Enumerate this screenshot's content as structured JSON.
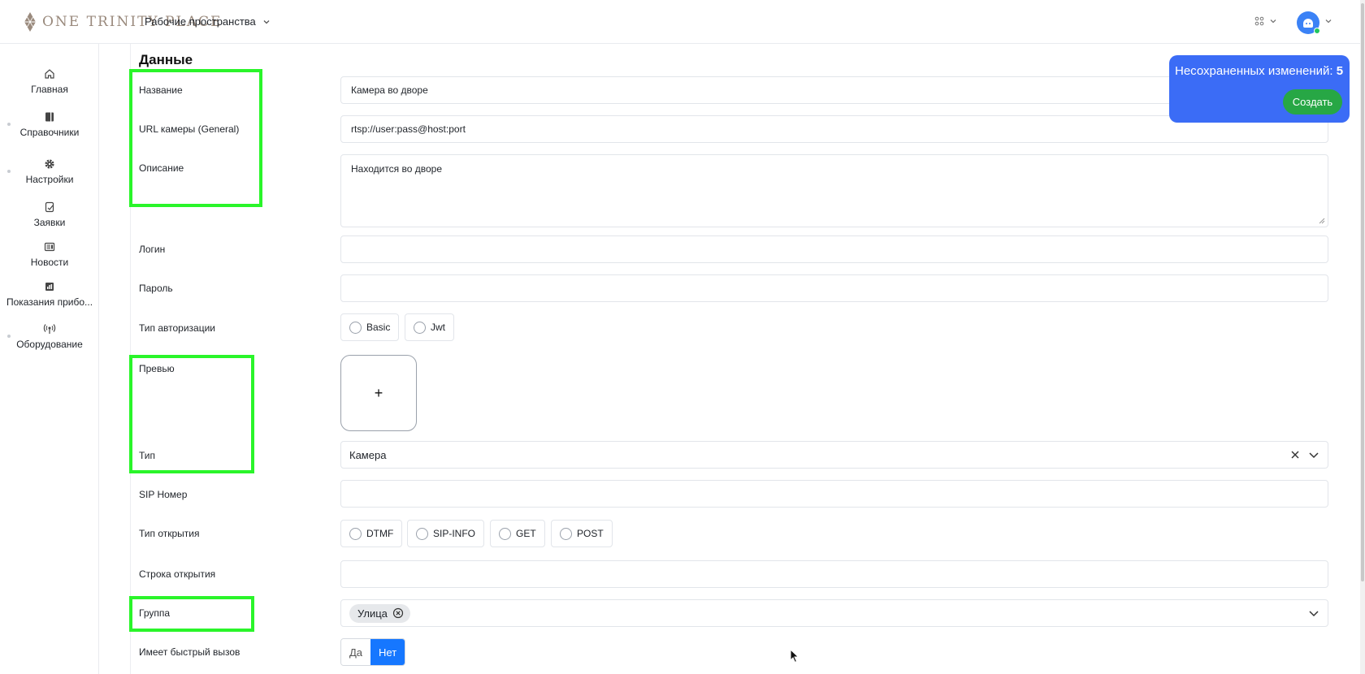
{
  "header": {
    "logo_text": "ONE TRINITY PLACE",
    "workspaces_label": "Рабочие пространства"
  },
  "sidebar": {
    "items": [
      {
        "label": "Главная",
        "icon": "home-icon"
      },
      {
        "label": "Справочники",
        "icon": "book-icon"
      },
      {
        "label": "Настройки",
        "icon": "gear-icon"
      },
      {
        "label": "Заявки",
        "icon": "request-icon"
      },
      {
        "label": "Новости",
        "icon": "news-icon"
      },
      {
        "label": "Показания прибо...",
        "icon": "chart-icon"
      },
      {
        "label": "Оборудование",
        "icon": "antenna-icon"
      }
    ]
  },
  "unsaved": {
    "label": "Несохраненных изменений:",
    "count": "5",
    "create_label": "Создать"
  },
  "form": {
    "section_title": "Данные",
    "name": {
      "label": "Название",
      "value": "Камера во дворе"
    },
    "url": {
      "label": "URL камеры (General)",
      "value": "rtsp://user:pass@host:port"
    },
    "description": {
      "label": "Описание",
      "value": "Находится во дворе"
    },
    "login": {
      "label": "Логин",
      "value": ""
    },
    "password": {
      "label": "Пароль",
      "value": ""
    },
    "auth_type": {
      "label": "Тип авторизации",
      "options": [
        "Basic",
        "Jwt"
      ]
    },
    "preview": {
      "label": "Превью",
      "upload_symbol": "+"
    },
    "type": {
      "label": "Тип",
      "value": "Камера"
    },
    "sip": {
      "label": "SIP Номер",
      "value": ""
    },
    "open_type": {
      "label": "Тип открытия",
      "options": [
        "DTMF",
        "SIP-INFO",
        "GET",
        "POST"
      ]
    },
    "open_string": {
      "label": "Строка открытия",
      "value": ""
    },
    "group": {
      "label": "Группа",
      "chip": "Улица"
    },
    "quick_call": {
      "label": "Имеет быстрый вызов",
      "options": [
        "Да",
        "Нет"
      ],
      "selected": "Нет"
    }
  },
  "colors": {
    "highlight": "#2af52a",
    "unsaved_panel": "#3b6cf6",
    "create_button": "#27a745",
    "toggle_active": "#1677ff"
  }
}
